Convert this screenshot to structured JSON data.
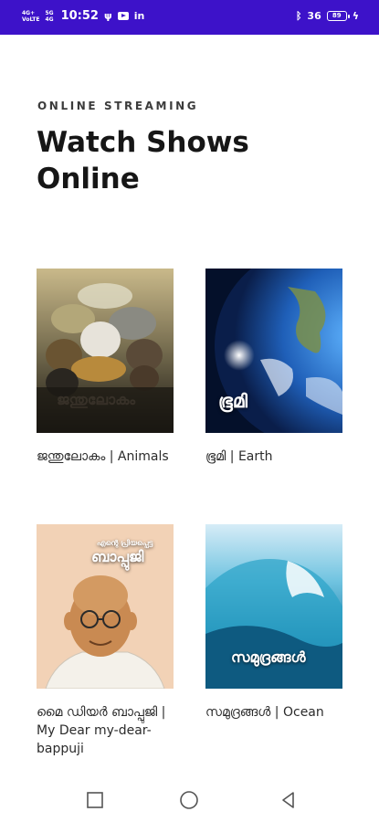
{
  "status_bar": {
    "time": "10:52",
    "signal_1": [
      "4G+",
      "VoLTE"
    ],
    "signal_2": [
      "5G",
      "4G"
    ],
    "right_text": "36",
    "battery": "89"
  },
  "header": {
    "eyebrow": "ONLINE STREAMING",
    "title": "Watch Shows Online"
  },
  "shows": [
    {
      "caption": "ജന്തുലോകം | Animals",
      "overlay": "ജന്തുലോകം"
    },
    {
      "caption": "ഭൂമി | Earth",
      "overlay": "ഭൂമി"
    },
    {
      "caption": "മൈ ഡിയർ ബാപ്പുജി | My Dear my-dear-bappuji",
      "overlay_small": "എന്റെ പ്രിയപ്പെട്ട",
      "overlay": "ബാപ്പുജി"
    },
    {
      "caption": "സമുദ്രങ്ങൾ | Ocean",
      "overlay": "സമുദ്രങ്ങൾ"
    }
  ],
  "colors": {
    "status_bar": "#3d12c9",
    "title": "#161616",
    "eyebrow": "#3c3c3c"
  },
  "icons": {
    "status": [
      "signal-icon",
      "usb-icon",
      "youtube-icon",
      "linkedin-icon",
      "bluetooth-icon",
      "battery-icon",
      "charging-icon"
    ],
    "nav": [
      "recent-apps-icon",
      "home-icon",
      "back-icon"
    ]
  }
}
